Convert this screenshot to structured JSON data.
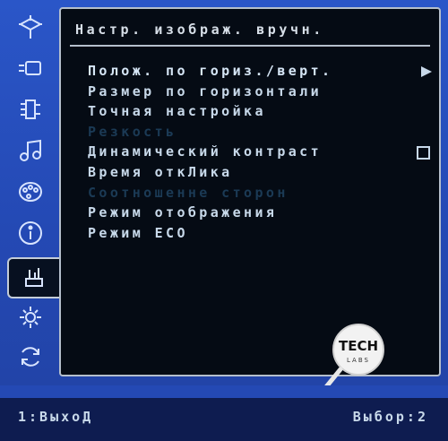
{
  "panel": {
    "title": "Настр. изображ. вручн."
  },
  "menu": {
    "items": [
      {
        "label": "Полож. по гориз./верт.",
        "state": "selected",
        "has_submenu": true
      },
      {
        "label": "Размер по горизонтали",
        "state": "normal"
      },
      {
        "label": "Точная настройка",
        "state": "normal"
      },
      {
        "label": "Резкость",
        "state": "disabled"
      },
      {
        "label": "Динамический контраст",
        "state": "normal",
        "checkbox": false
      },
      {
        "label": "Время откЛика",
        "state": "normal"
      },
      {
        "label": "Соотношенне сторон",
        "state": "disabled"
      },
      {
        "label": "Режим отображения",
        "state": "normal"
      },
      {
        "label": "Режим ECO",
        "state": "normal"
      }
    ]
  },
  "sidebar": {
    "icons": [
      "input-select-icon",
      "brightness-contrast-icon",
      "image-setup-icon",
      "audio-adjust-icon",
      "color-adjust-icon",
      "information-icon",
      "manual-image-adjust-icon",
      "setup-menu-icon",
      "memory-recall-icon"
    ],
    "active_index": 6
  },
  "footer": {
    "exit_label": "1:ВыхоД",
    "select_label": "Выбор:2"
  },
  "watermark": {
    "text": "TECH LABS"
  },
  "colors": {
    "frame": "#2449b4",
    "panel": "#050b14",
    "text": "#c8d9ea",
    "disabled_text": "#1b3a55"
  }
}
